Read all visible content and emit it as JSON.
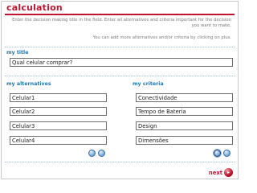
{
  "page": {
    "title": "calculation",
    "intro_line1": "Enter the decision making title in the field. Enter all alternatives and criteria important for the decision you want to make.",
    "intro_line2": "You can add more alternatives and/or criteria by clicking on plus."
  },
  "title_section": {
    "label": "my title",
    "value": "Qual celular comprar?"
  },
  "alternatives": {
    "label": "my alternatives",
    "items": [
      "Celular1",
      "Celular2",
      "Celular3",
      "Celular4"
    ]
  },
  "criteria": {
    "label": "my criteria",
    "items": [
      "Conectividade",
      "Tempo de Bateria",
      "Design",
      "Dimensões"
    ]
  },
  "footer": {
    "next_label": "next",
    "next_icon": "▸"
  },
  "colors": {
    "accent_red": "#c0152f",
    "label_blue": "#1f78b4"
  },
  "icons": {
    "nav_buttons": "blue-round-button-icon",
    "next": "red-round-arrow-icon"
  }
}
